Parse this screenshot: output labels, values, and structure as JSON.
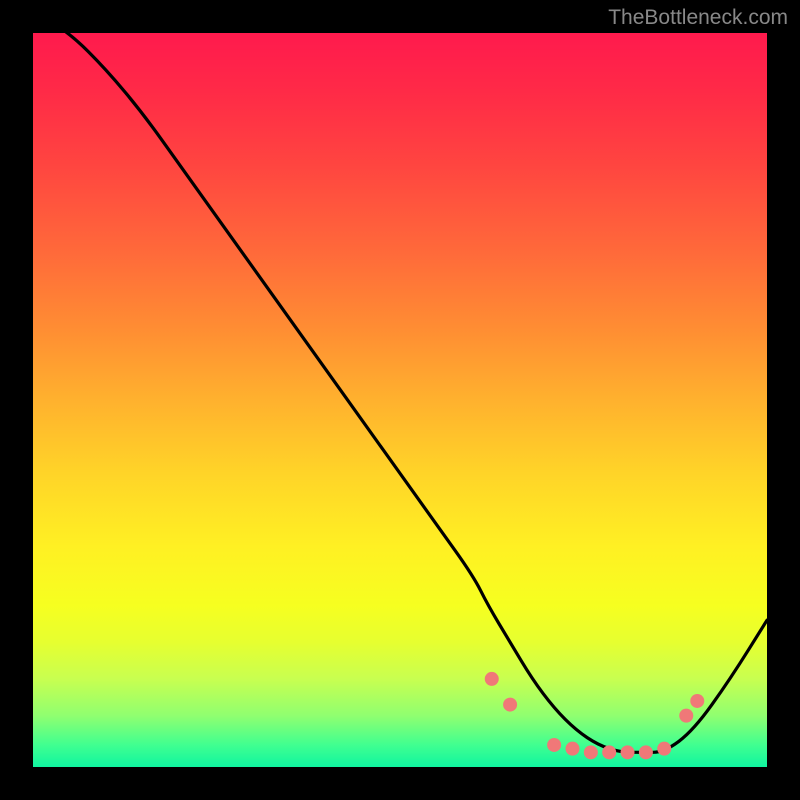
{
  "attribution": "TheBottleneck.com",
  "chart_data": {
    "type": "line",
    "title": "",
    "xlabel": "",
    "ylabel": "",
    "xlim": [
      0,
      100
    ],
    "ylim": [
      0,
      100
    ],
    "grid": false,
    "series": [
      {
        "name": "curve",
        "x": [
          0,
          5,
          10,
          15,
          20,
          25,
          30,
          35,
          40,
          45,
          50,
          55,
          60,
          62,
          65,
          68,
          71,
          74,
          77,
          80,
          83,
          86,
          90,
          95,
          100
        ],
        "y": [
          103,
          100,
          95,
          89,
          82,
          75,
          68,
          61,
          54,
          47,
          40,
          33,
          26,
          22,
          17,
          12,
          8,
          5,
          3,
          2,
          2,
          2,
          5,
          12,
          20
        ]
      }
    ],
    "markers": {
      "name": "dots",
      "color": "#f07878",
      "x": [
        62.5,
        65,
        71,
        73.5,
        76,
        78.5,
        81,
        83.5,
        86,
        89,
        90.5
      ],
      "y": [
        12,
        8.5,
        3,
        2.5,
        2,
        2,
        2,
        2,
        2.5,
        7,
        9
      ]
    }
  }
}
